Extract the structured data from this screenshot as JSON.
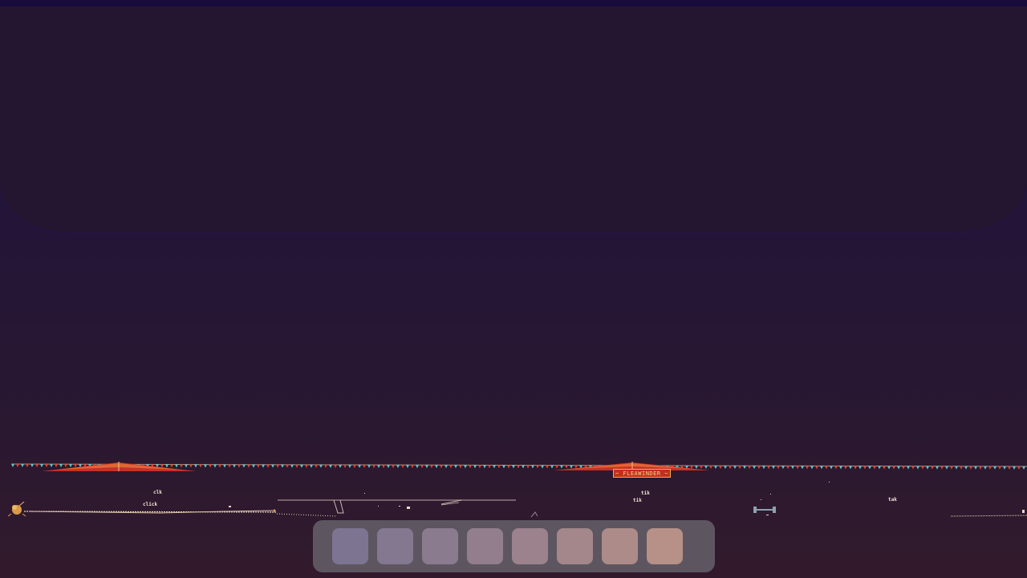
{
  "scene": {
    "sign_text": "~ FLEAWINDER ~",
    "sound_effects": [
      {
        "id": "sfx-1",
        "text": "clk"
      },
      {
        "id": "sfx-2",
        "text": "click"
      },
      {
        "id": "sfx-3",
        "text": "tik"
      },
      {
        "id": "sfx-4",
        "text": "tik"
      },
      {
        "id": "sfx-5",
        "text": "tak"
      }
    ]
  },
  "hotbar": {
    "slots": [
      {
        "color": "#7d7492"
      },
      {
        "color": "#847890"
      },
      {
        "color": "#8b7b8f"
      },
      {
        "color": "#927e8d"
      },
      {
        "color": "#9b828c"
      },
      {
        "color": "#a4878b"
      },
      {
        "color": "#ad8b89"
      },
      {
        "color": "#b79087"
      }
    ]
  },
  "colors": {
    "tent_red": "#c8302a",
    "bunting_cyan": "#5fc6c8",
    "bunting_red": "#d8453a",
    "ground_line": "#e8d4b8",
    "flea": "#d99a4a"
  }
}
